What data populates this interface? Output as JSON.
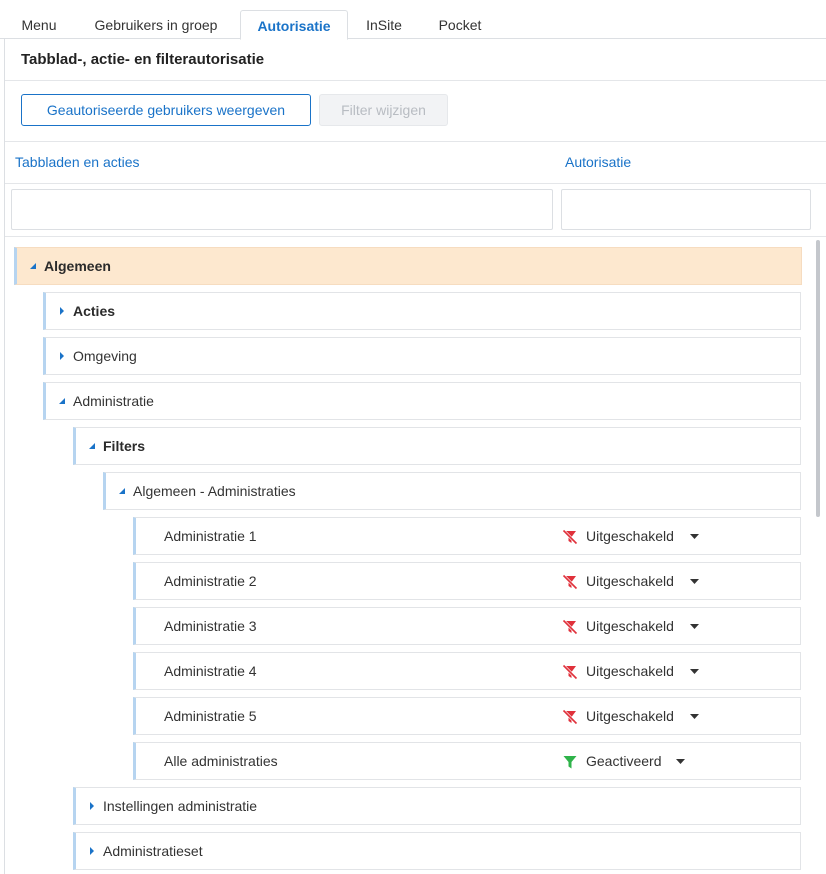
{
  "tabs": [
    {
      "label": "Menu",
      "active": false
    },
    {
      "label": "Gebruikers in groep",
      "active": false
    },
    {
      "label": "Autorisatie",
      "active": true
    },
    {
      "label": "InSite",
      "active": false
    },
    {
      "label": "Pocket",
      "active": false
    }
  ],
  "panel": {
    "title": "Tabblad-, actie- en filterautorisatie",
    "buttons": {
      "show_users": "Geautoriseerde gebruikers weergeven",
      "change_filter": "Filter wijzigen"
    },
    "columns": {
      "tabs_actions": "Tabbladen en acties",
      "authorization": "Autorisatie"
    },
    "filters": {
      "tabs_actions_value": "",
      "authorization_value": ""
    }
  },
  "tree": {
    "algemeen": {
      "label": "Algemeen",
      "expanded": true,
      "selected": true
    },
    "acties": {
      "label": "Acties",
      "expanded": false
    },
    "omgeving": {
      "label": "Omgeving",
      "expanded": false
    },
    "administratie": {
      "label": "Administratie",
      "expanded": true
    },
    "filters": {
      "label": "Filters",
      "expanded": true
    },
    "algemeen_administraties": {
      "label": "Algemeen - Administraties",
      "expanded": true
    },
    "leaves": [
      {
        "label": "Administratie 1",
        "status": "Uitgeschakeld",
        "status_icon": "filter-off-icon"
      },
      {
        "label": "Administratie 2",
        "status": "Uitgeschakeld",
        "status_icon": "filter-off-icon"
      },
      {
        "label": "Administratie 3",
        "status": "Uitgeschakeld",
        "status_icon": "filter-off-icon"
      },
      {
        "label": "Administratie 4",
        "status": "Uitgeschakeld",
        "status_icon": "filter-off-icon"
      },
      {
        "label": "Administratie 5",
        "status": "Uitgeschakeld",
        "status_icon": "filter-off-icon"
      },
      {
        "label": "Alle administraties",
        "status": "Geactiveerd",
        "status_icon": "filter-on-icon"
      }
    ],
    "instellingen_administratie": {
      "label": "Instellingen administratie",
      "expanded": false
    },
    "administratieset": {
      "label": "Administratieset",
      "expanded": false
    }
  },
  "colors": {
    "accent": "#1a73c8",
    "selected_row": "#fde8cf",
    "disabled_status": "#e0313b",
    "active_status": "#2fb34a"
  }
}
